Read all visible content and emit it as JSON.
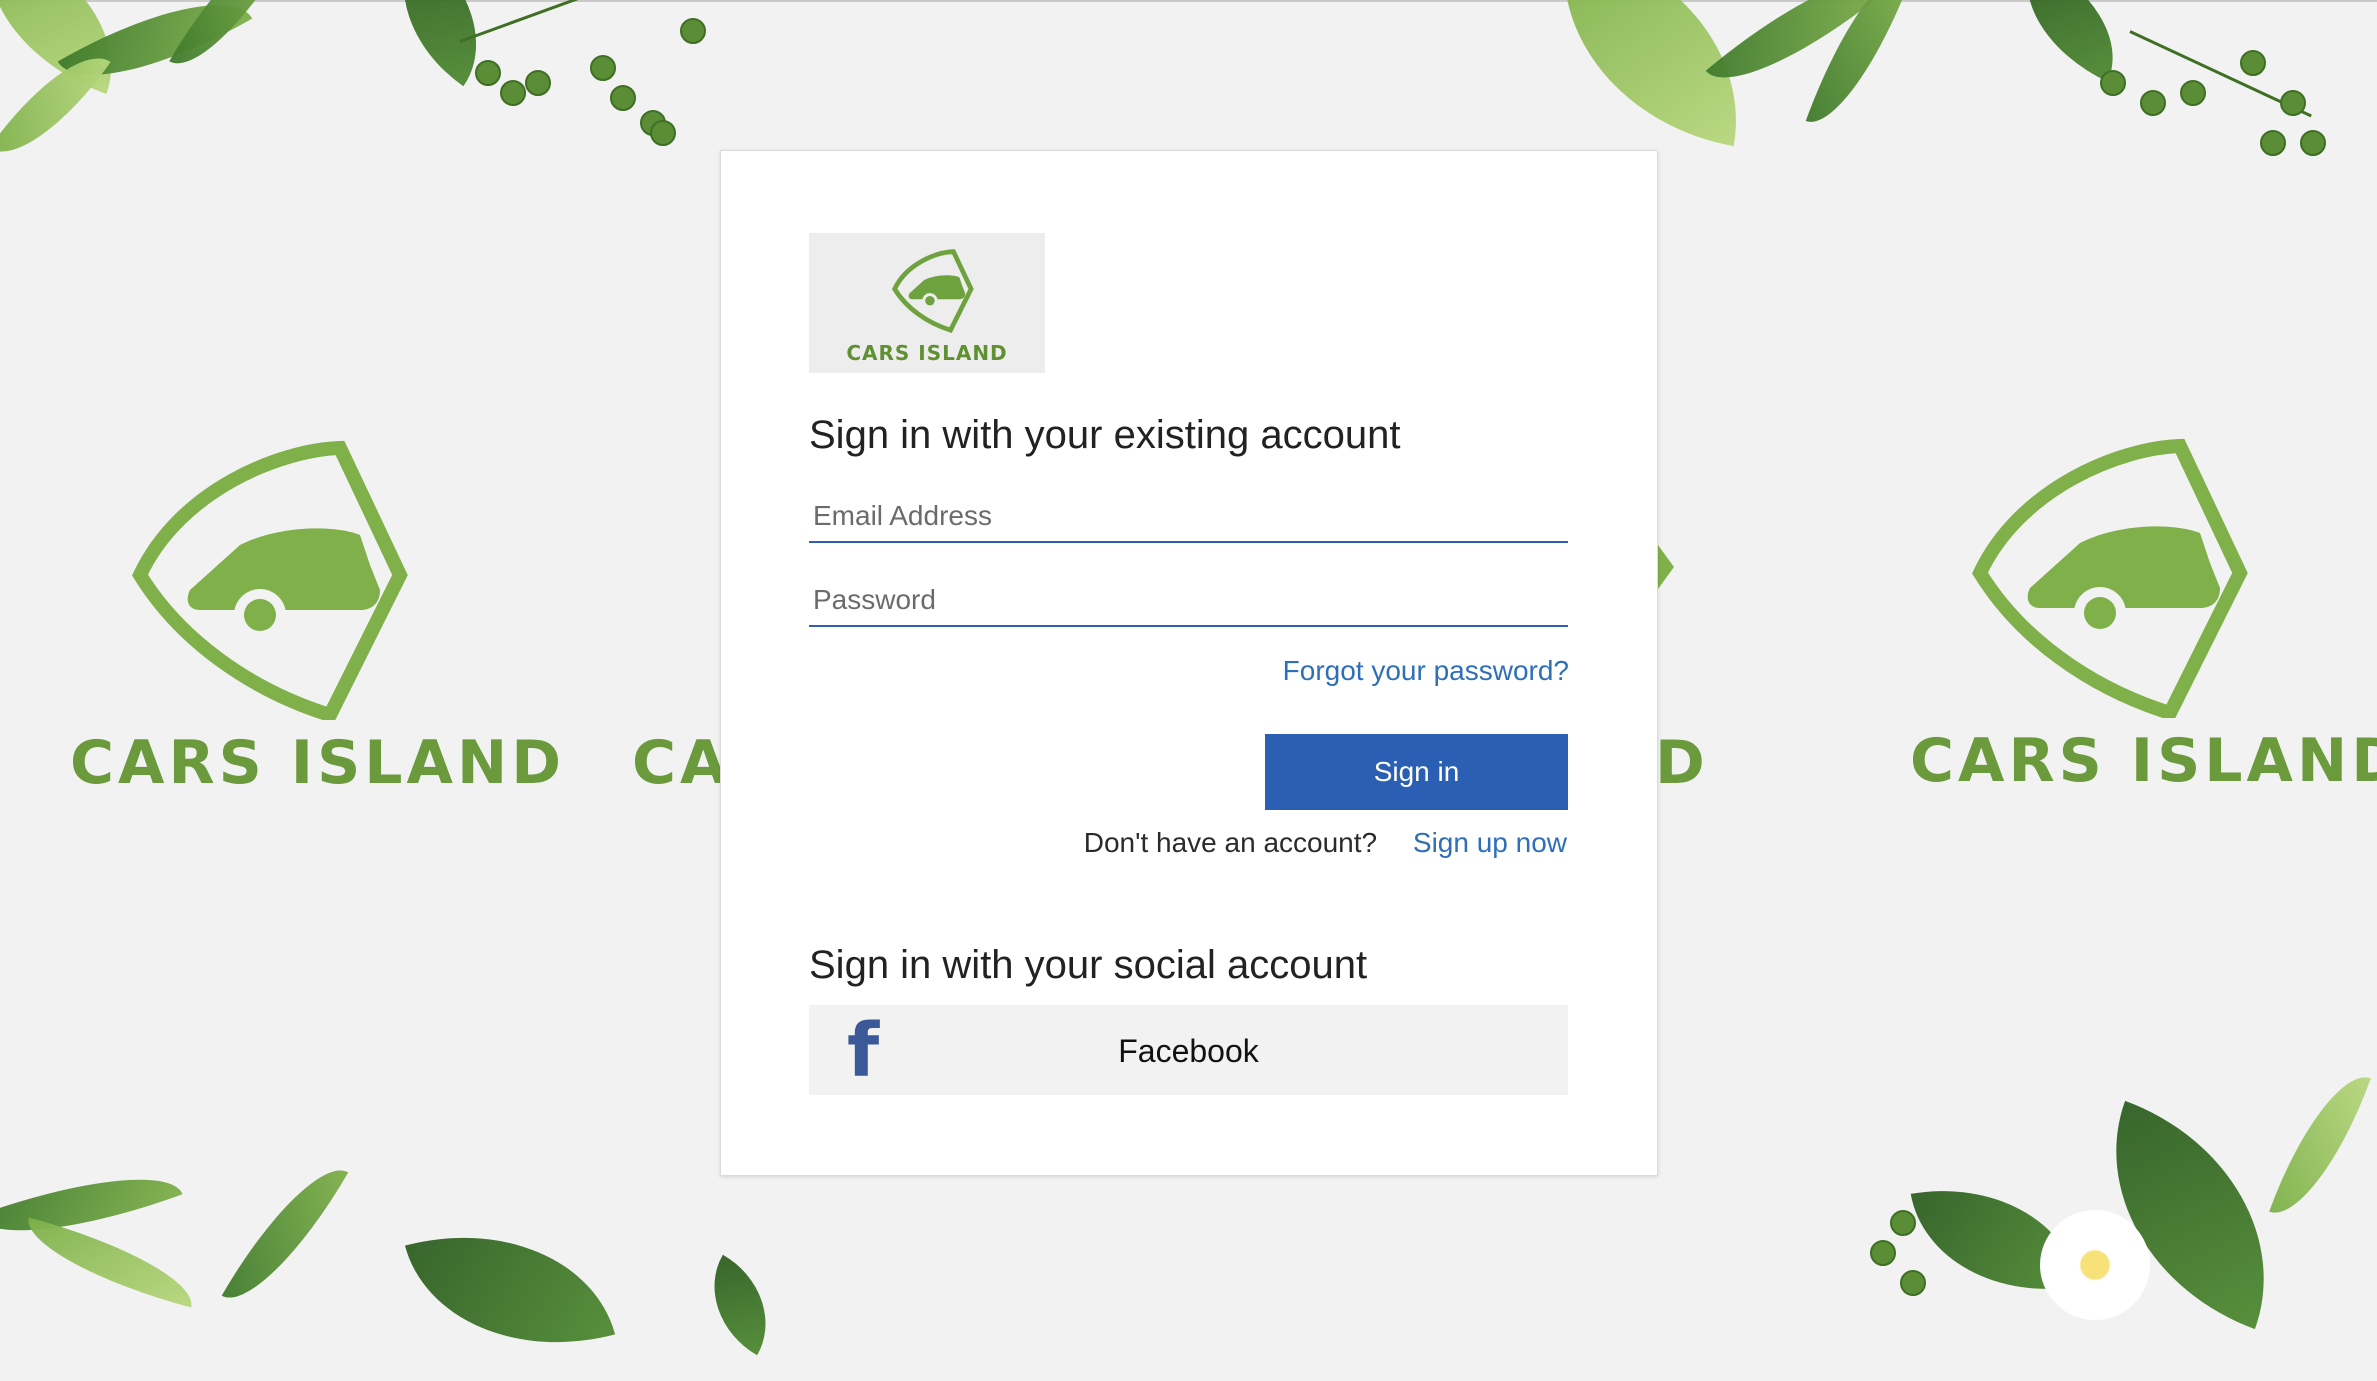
{
  "brand": {
    "name": "CARS ISLAND",
    "partial_left": "CA",
    "partial_right": "D",
    "color": "#6a9a3c"
  },
  "signin": {
    "heading": "Sign in with your existing account",
    "email_placeholder": "Email Address",
    "password_placeholder": "Password",
    "forgot_label": "Forgot your password?",
    "button_label": "Sign in",
    "signup_prompt": "Don't have an account?",
    "signup_link": "Sign up now"
  },
  "social": {
    "heading": "Sign in with your social account",
    "facebook_label": "Facebook",
    "facebook_glyph": "f"
  },
  "colors": {
    "primary": "#2a5fb4",
    "link": "#2f6fb8",
    "facebook": "#3b5998",
    "background": "#f2f2f2"
  }
}
